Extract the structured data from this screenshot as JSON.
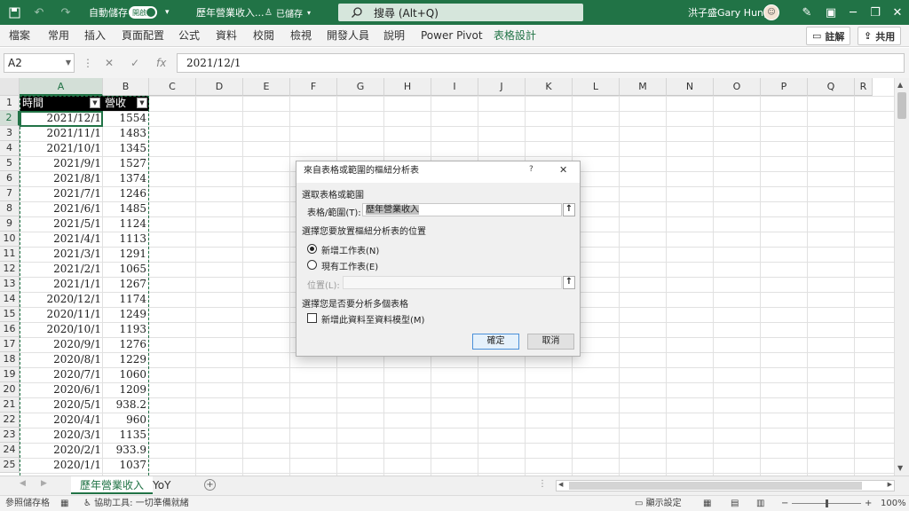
{
  "titlebar": {
    "autosave_label": "自動儲存",
    "autosave_state": "開啟",
    "document_name": "歷年營業收入...",
    "save_status": "已儲存",
    "search_placeholder": "搜尋 (Alt+Q)",
    "user_name": "洪子盛Gary Hung",
    "accent_color": "#217346"
  },
  "ribbon": {
    "tabs": [
      "檔案",
      "常用",
      "插入",
      "頁面配置",
      "公式",
      "資料",
      "校閱",
      "檢視",
      "開發人員",
      "說明",
      "Power Pivot",
      "表格設計"
    ],
    "comment_button": "註解",
    "share_button": "共用"
  },
  "formula_bar": {
    "name_box": "A2",
    "fx_symbol": "fx",
    "value": "2021/12/1"
  },
  "grid": {
    "columns": [
      "A",
      "B",
      "C",
      "D",
      "E",
      "F",
      "G",
      "H",
      "I",
      "J",
      "K",
      "L",
      "M",
      "N",
      "O",
      "P",
      "Q",
      "R"
    ],
    "rows": [
      "1",
      "2",
      "3",
      "4",
      "5",
      "6",
      "7",
      "8",
      "9",
      "10",
      "11",
      "12",
      "13",
      "14",
      "15",
      "16",
      "17",
      "18",
      "19",
      "20",
      "21",
      "22",
      "23",
      "24",
      "25"
    ],
    "header_a": "時間",
    "header_b": "營收",
    "dates": [
      "2021/12/1",
      "2021/11/1",
      "2021/10/1",
      "2021/9/1",
      "2021/8/1",
      "2021/7/1",
      "2021/6/1",
      "2021/5/1",
      "2021/4/1",
      "2021/3/1",
      "2021/2/1",
      "2021/1/1",
      "2020/12/1",
      "2020/11/1",
      "2020/10/1",
      "2020/9/1",
      "2020/8/1",
      "2020/7/1",
      "2020/6/1",
      "2020/5/1",
      "2020/4/1",
      "2020/3/1",
      "2020/2/1",
      "2020/1/1"
    ],
    "revenue": [
      "1554",
      "1483",
      "1345",
      "1527",
      "1374",
      "1246",
      "1485",
      "1124",
      "1113",
      "1291",
      "1065",
      "1267",
      "1174",
      "1249",
      "1193",
      "1276",
      "1229",
      "1060",
      "1209",
      "938.2",
      "960",
      "1135",
      "933.9",
      "1037"
    ]
  },
  "dialog": {
    "title": "來自表格或範圍的樞紐分析表",
    "help": "?",
    "close": "✕",
    "section_select": "選取表格或範圍",
    "table_range_label": "表格/範圍(T):",
    "table_range_value": "歷年營業收入",
    "section_location": "選擇您要放置樞紐分析表的位置",
    "option_new": "新增工作表(N)",
    "option_existing": "現有工作表(E)",
    "location_label": "位置(L):",
    "location_value": "",
    "section_multi": "選擇您是否要分析多個表格",
    "data_model_label": "新增此資料至資料模型(M)",
    "ok_button": "確定",
    "cancel_button": "取消"
  },
  "sheets": {
    "tabs": [
      "歷年營業收入",
      "YoY"
    ]
  },
  "statusbar": {
    "ready": "參照儲存格",
    "accessibility": "協助工具: 一切準備就緒",
    "display_settings": "顯示設定",
    "zoom": "100%"
  }
}
